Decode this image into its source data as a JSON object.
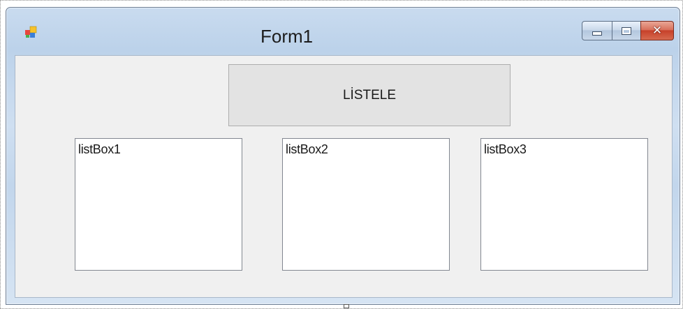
{
  "window": {
    "title": "Form1",
    "icons": {
      "app": "form-app-icon",
      "minimize": "minimize-icon",
      "maximize": "maximize-icon",
      "close": "close-icon"
    },
    "close_glyph": "✕",
    "colors": {
      "frame": "#c2d6ec",
      "client": "#f0f0f0",
      "close_button": "#c7412a"
    }
  },
  "form": {
    "button_label": "LİSTELE",
    "list_boxes": [
      {
        "label": "listBox1"
      },
      {
        "label": "listBox2"
      },
      {
        "label": "listBox3"
      }
    ]
  }
}
